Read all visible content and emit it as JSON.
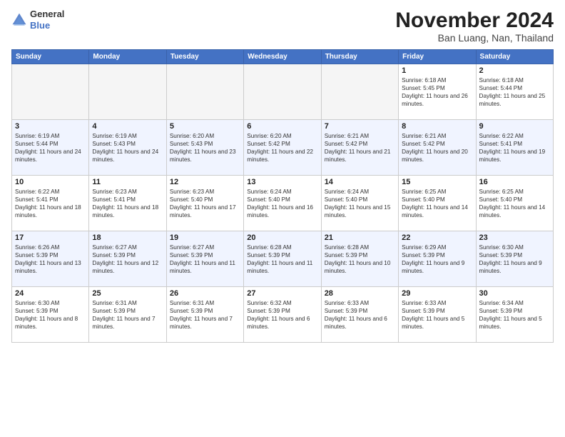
{
  "logo": {
    "text_general": "General",
    "text_blue": "Blue"
  },
  "title": {
    "month": "November 2024",
    "location": "Ban Luang, Nan, Thailand"
  },
  "weekdays": [
    "Sunday",
    "Monday",
    "Tuesday",
    "Wednesday",
    "Thursday",
    "Friday",
    "Saturday"
  ],
  "weeks": [
    [
      {
        "day": "",
        "empty": true
      },
      {
        "day": "",
        "empty": true
      },
      {
        "day": "",
        "empty": true
      },
      {
        "day": "",
        "empty": true
      },
      {
        "day": "",
        "empty": true
      },
      {
        "day": "1",
        "sunrise": "Sunrise: 6:18 AM",
        "sunset": "Sunset: 5:45 PM",
        "daylight": "Daylight: 11 hours and 26 minutes."
      },
      {
        "day": "2",
        "sunrise": "Sunrise: 6:18 AM",
        "sunset": "Sunset: 5:44 PM",
        "daylight": "Daylight: 11 hours and 25 minutes."
      }
    ],
    [
      {
        "day": "3",
        "sunrise": "Sunrise: 6:19 AM",
        "sunset": "Sunset: 5:44 PM",
        "daylight": "Daylight: 11 hours and 24 minutes."
      },
      {
        "day": "4",
        "sunrise": "Sunrise: 6:19 AM",
        "sunset": "Sunset: 5:43 PM",
        "daylight": "Daylight: 11 hours and 24 minutes."
      },
      {
        "day": "5",
        "sunrise": "Sunrise: 6:20 AM",
        "sunset": "Sunset: 5:43 PM",
        "daylight": "Daylight: 11 hours and 23 minutes."
      },
      {
        "day": "6",
        "sunrise": "Sunrise: 6:20 AM",
        "sunset": "Sunset: 5:42 PM",
        "daylight": "Daylight: 11 hours and 22 minutes."
      },
      {
        "day": "7",
        "sunrise": "Sunrise: 6:21 AM",
        "sunset": "Sunset: 5:42 PM",
        "daylight": "Daylight: 11 hours and 21 minutes."
      },
      {
        "day": "8",
        "sunrise": "Sunrise: 6:21 AM",
        "sunset": "Sunset: 5:42 PM",
        "daylight": "Daylight: 11 hours and 20 minutes."
      },
      {
        "day": "9",
        "sunrise": "Sunrise: 6:22 AM",
        "sunset": "Sunset: 5:41 PM",
        "daylight": "Daylight: 11 hours and 19 minutes."
      }
    ],
    [
      {
        "day": "10",
        "sunrise": "Sunrise: 6:22 AM",
        "sunset": "Sunset: 5:41 PM",
        "daylight": "Daylight: 11 hours and 18 minutes."
      },
      {
        "day": "11",
        "sunrise": "Sunrise: 6:23 AM",
        "sunset": "Sunset: 5:41 PM",
        "daylight": "Daylight: 11 hours and 18 minutes."
      },
      {
        "day": "12",
        "sunrise": "Sunrise: 6:23 AM",
        "sunset": "Sunset: 5:40 PM",
        "daylight": "Daylight: 11 hours and 17 minutes."
      },
      {
        "day": "13",
        "sunrise": "Sunrise: 6:24 AM",
        "sunset": "Sunset: 5:40 PM",
        "daylight": "Daylight: 11 hours and 16 minutes."
      },
      {
        "day": "14",
        "sunrise": "Sunrise: 6:24 AM",
        "sunset": "Sunset: 5:40 PM",
        "daylight": "Daylight: 11 hours and 15 minutes."
      },
      {
        "day": "15",
        "sunrise": "Sunrise: 6:25 AM",
        "sunset": "Sunset: 5:40 PM",
        "daylight": "Daylight: 11 hours and 14 minutes."
      },
      {
        "day": "16",
        "sunrise": "Sunrise: 6:25 AM",
        "sunset": "Sunset: 5:40 PM",
        "daylight": "Daylight: 11 hours and 14 minutes."
      }
    ],
    [
      {
        "day": "17",
        "sunrise": "Sunrise: 6:26 AM",
        "sunset": "Sunset: 5:39 PM",
        "daylight": "Daylight: 11 hours and 13 minutes."
      },
      {
        "day": "18",
        "sunrise": "Sunrise: 6:27 AM",
        "sunset": "Sunset: 5:39 PM",
        "daylight": "Daylight: 11 hours and 12 minutes."
      },
      {
        "day": "19",
        "sunrise": "Sunrise: 6:27 AM",
        "sunset": "Sunset: 5:39 PM",
        "daylight": "Daylight: 11 hours and 11 minutes."
      },
      {
        "day": "20",
        "sunrise": "Sunrise: 6:28 AM",
        "sunset": "Sunset: 5:39 PM",
        "daylight": "Daylight: 11 hours and 11 minutes."
      },
      {
        "day": "21",
        "sunrise": "Sunrise: 6:28 AM",
        "sunset": "Sunset: 5:39 PM",
        "daylight": "Daylight: 11 hours and 10 minutes."
      },
      {
        "day": "22",
        "sunrise": "Sunrise: 6:29 AM",
        "sunset": "Sunset: 5:39 PM",
        "daylight": "Daylight: 11 hours and 9 minutes."
      },
      {
        "day": "23",
        "sunrise": "Sunrise: 6:30 AM",
        "sunset": "Sunset: 5:39 PM",
        "daylight": "Daylight: 11 hours and 9 minutes."
      }
    ],
    [
      {
        "day": "24",
        "sunrise": "Sunrise: 6:30 AM",
        "sunset": "Sunset: 5:39 PM",
        "daylight": "Daylight: 11 hours and 8 minutes."
      },
      {
        "day": "25",
        "sunrise": "Sunrise: 6:31 AM",
        "sunset": "Sunset: 5:39 PM",
        "daylight": "Daylight: 11 hours and 7 minutes."
      },
      {
        "day": "26",
        "sunrise": "Sunrise: 6:31 AM",
        "sunset": "Sunset: 5:39 PM",
        "daylight": "Daylight: 11 hours and 7 minutes."
      },
      {
        "day": "27",
        "sunrise": "Sunrise: 6:32 AM",
        "sunset": "Sunset: 5:39 PM",
        "daylight": "Daylight: 11 hours and 6 minutes."
      },
      {
        "day": "28",
        "sunrise": "Sunrise: 6:33 AM",
        "sunset": "Sunset: 5:39 PM",
        "daylight": "Daylight: 11 hours and 6 minutes."
      },
      {
        "day": "29",
        "sunrise": "Sunrise: 6:33 AM",
        "sunset": "Sunset: 5:39 PM",
        "daylight": "Daylight: 11 hours and 5 minutes."
      },
      {
        "day": "30",
        "sunrise": "Sunrise: 6:34 AM",
        "sunset": "Sunset: 5:39 PM",
        "daylight": "Daylight: 11 hours and 5 minutes."
      }
    ]
  ]
}
